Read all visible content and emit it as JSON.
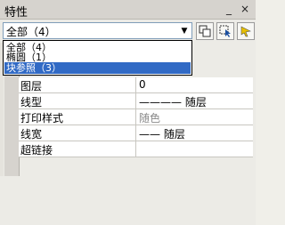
{
  "window": {
    "title": "特性",
    "min_glyph": "_",
    "close_glyph": "×"
  },
  "toolbar": {
    "selection": "全部（4）",
    "dropdown_arrow": "▼",
    "buttons": [
      {
        "name": "toggle-pickadd-button",
        "icon": "pickadd-icon"
      },
      {
        "name": "select-objects-button",
        "icon": "cursor-icon"
      },
      {
        "name": "quick-select-button",
        "icon": "quick-select-icon"
      }
    ]
  },
  "dropdown": {
    "items": [
      {
        "label": "全部（4）",
        "selected": false
      },
      {
        "label": "椭圆（1）",
        "selected": false
      },
      {
        "label": "块参照（3）",
        "selected": true
      }
    ]
  },
  "properties": [
    {
      "key": "图层",
      "value": "0",
      "muted": false
    },
    {
      "key": "线型",
      "value": "———— 随层",
      "muted": false
    },
    {
      "key": "打印样式",
      "value": "随色",
      "muted": true
    },
    {
      "key": "线宽",
      "value": "—— 随层",
      "muted": false
    },
    {
      "key": "超链接",
      "value": "",
      "muted": false
    }
  ]
}
